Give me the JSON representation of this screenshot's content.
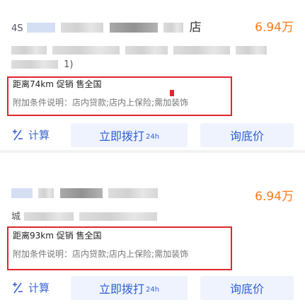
{
  "listings": [
    {
      "name_fragment": "4S",
      "name_tail": "店",
      "price": "6.94万",
      "subtitle_fragment": "1)",
      "distance_line": "距离74km 促销 售全国",
      "conditions": "附加条件说明：店内贷款;店内上保险;需加装饰"
    },
    {
      "name_fragment": "",
      "name_tail": "",
      "price": "6.94万",
      "subtitle_fragment": "城",
      "distance_line": "距离93km 促销 售全国",
      "conditions": "附加条件说明：店内贷款;店内上保险;需加装饰"
    }
  ],
  "actions": {
    "calc_label": "计算",
    "call_label": "立即拨打",
    "call_tag": "24h",
    "inquire_label": "询底价"
  },
  "colors": {
    "price": "#ff7a1a",
    "accent": "#2f5fd6",
    "highlight_border": "#e0262f",
    "button_bg": "#eef3fd"
  },
  "icons": {
    "calc": "calculator-icon"
  }
}
